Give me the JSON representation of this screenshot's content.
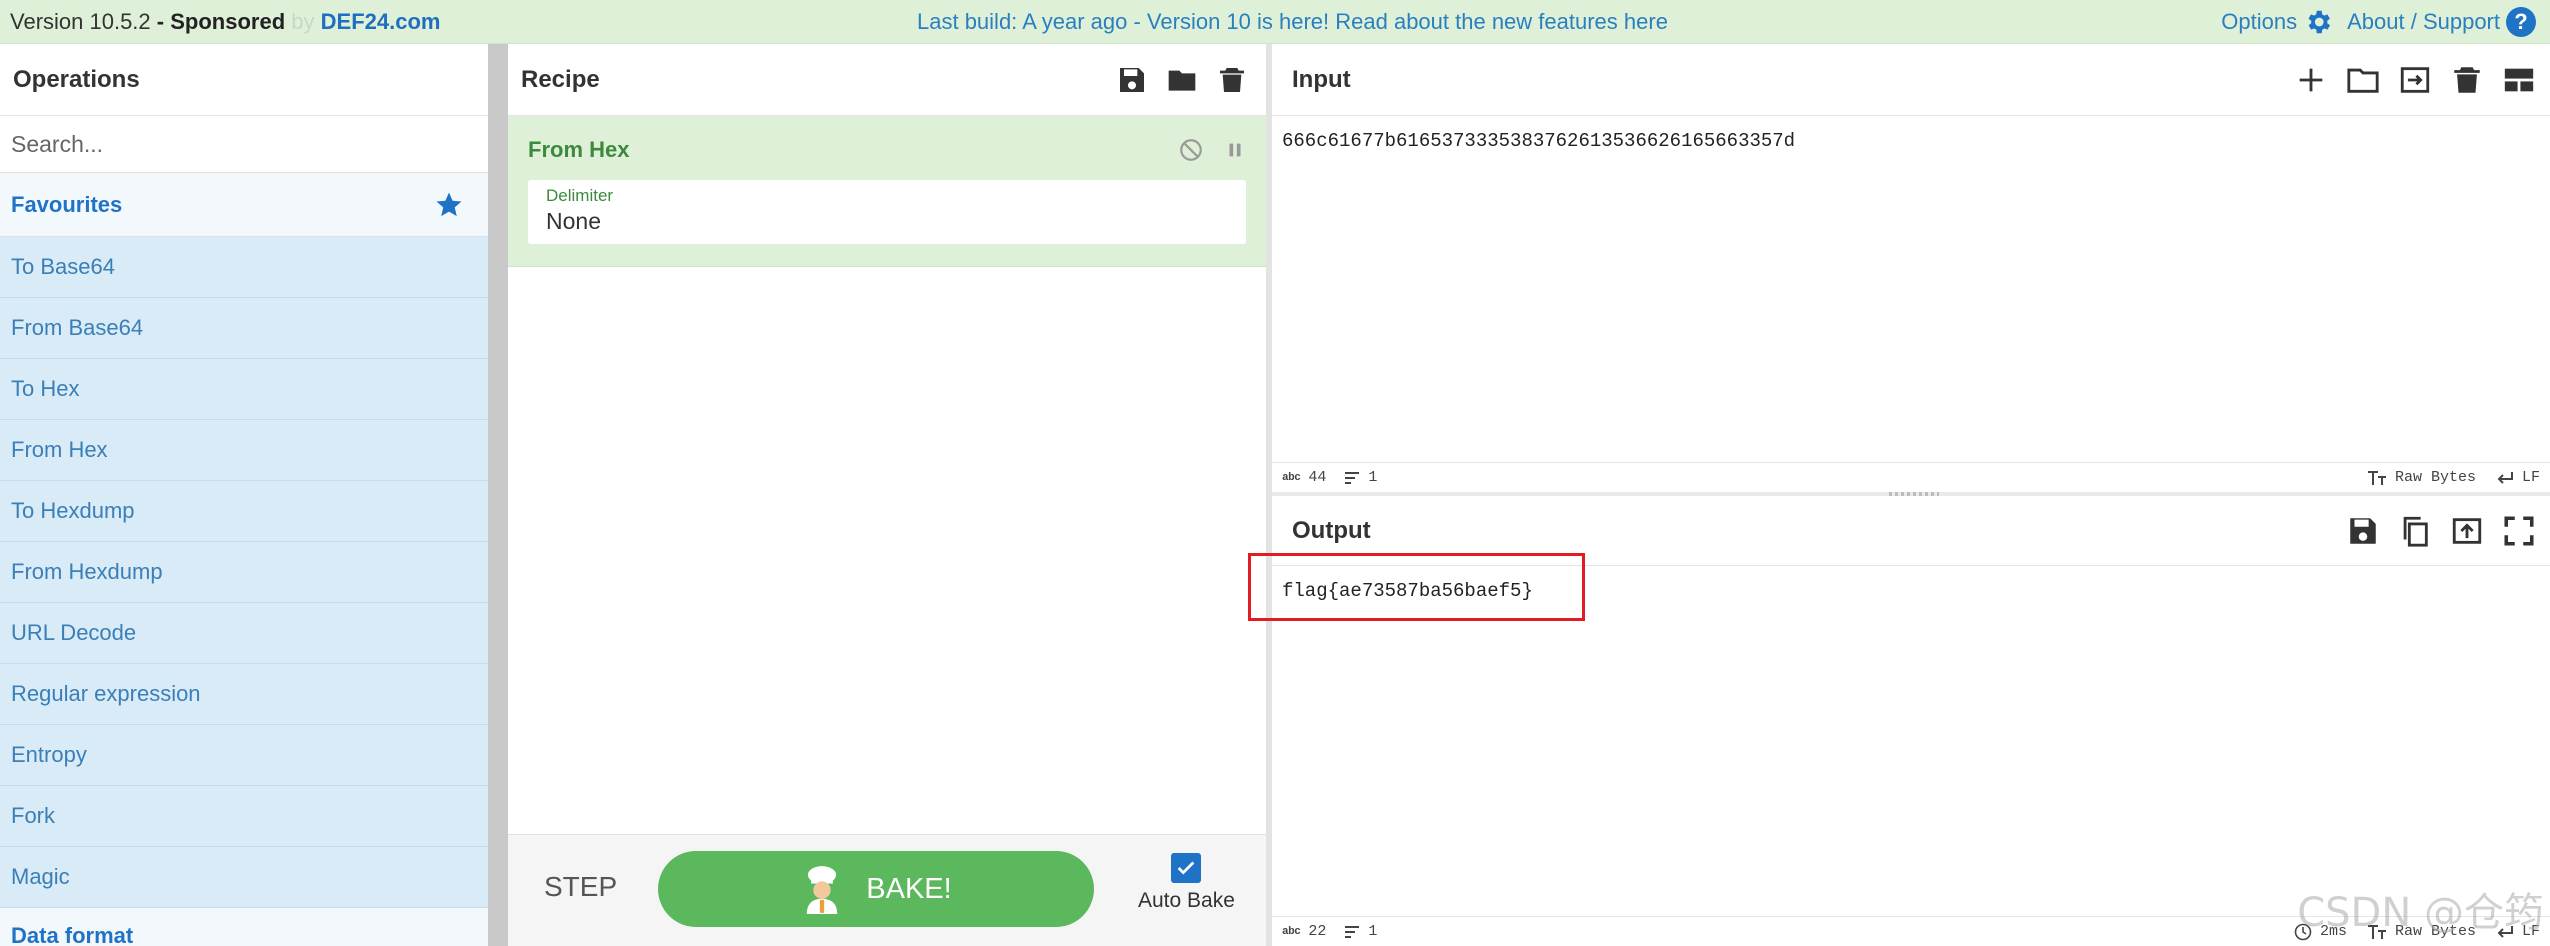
{
  "banner": {
    "version": "Version 10.5.2",
    "separator": " - ",
    "sponsored": "Sponsored",
    "by": "by",
    "sponsor_name": "DEF24.com",
    "notice": "Last build: A year ago - Version 10 is here! Read about the new features here",
    "options_label": "Options",
    "about_label": "About / Support",
    "help_glyph": "?"
  },
  "operations": {
    "title": "Operations",
    "search_placeholder": "Search...",
    "favourites_label": "Favourites",
    "items": [
      "To Base64",
      "From Base64",
      "To Hex",
      "From Hex",
      "To Hexdump",
      "From Hexdump",
      "URL Decode",
      "Regular expression",
      "Entropy",
      "Fork",
      "Magic"
    ],
    "next_category": "Data format"
  },
  "recipe": {
    "title": "Recipe",
    "operation": {
      "name": "From Hex",
      "delimiter_label": "Delimiter",
      "delimiter_value": "None"
    },
    "step_label": "STEP",
    "bake_label": "BAKE!",
    "auto_bake_label": "Auto Bake",
    "auto_bake_checked": true
  },
  "input": {
    "title": "Input",
    "text": "666c61677b6165373335383762613536626165663357d",
    "length": "44",
    "lines": "1",
    "encoding_label": "Raw Bytes",
    "eol_label": "LF"
  },
  "output": {
    "title": "Output",
    "text": "flag{ae73587ba56baef5}",
    "length": "22",
    "lines": "1",
    "time": "2ms",
    "encoding_label": "Raw Bytes",
    "eol_label": "LF"
  },
  "watermark": "CSDN @仓筠",
  "colors": {
    "banner_bg": "#dff0d8",
    "accent_blue": "#1f73c6",
    "op_item_bg": "#d9ebf6",
    "recipe_green": "#5cb85c",
    "highlight_red": "#e31c23"
  }
}
